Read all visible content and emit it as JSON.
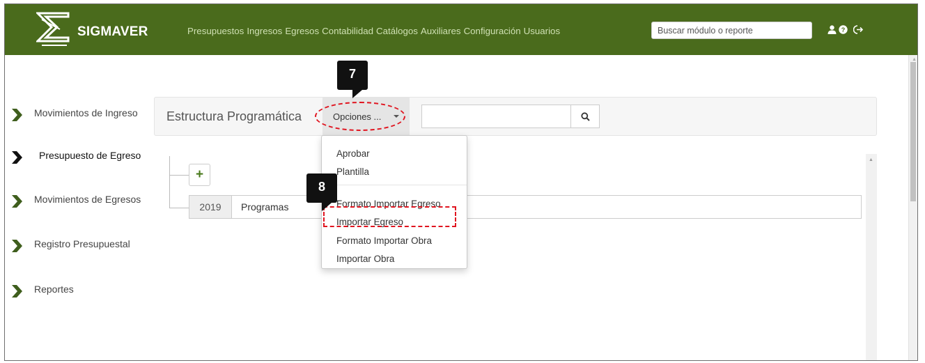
{
  "app": {
    "brand": "SIGMAVER",
    "colors": {
      "topbar": "#4a6b1c",
      "nav_text": "#cfe0b3",
      "chevron": "#3f5e1d",
      "annotation": "#e0141f"
    }
  },
  "nav": {
    "items": [
      "Presupuestos",
      "Ingresos",
      "Egresos",
      "Contabilidad",
      "Catálogos",
      "Auxiliares",
      "Configuración",
      "Usuarios"
    ],
    "search_placeholder": "Buscar módulo o reporte",
    "icons": [
      "user-icon",
      "help-icon",
      "logout-icon"
    ]
  },
  "sidebar": {
    "items": [
      {
        "label": "Movimientos de Ingreso"
      },
      {
        "label": "Presupuesto de Egreso"
      },
      {
        "label": "Movimientos de Egresos"
      },
      {
        "label": "Registro Presupuestal"
      },
      {
        "label": "Reportes"
      }
    ]
  },
  "toolbar": {
    "title": "Estructura Programática",
    "options_label": "Opciones ...",
    "search_value": ""
  },
  "tree": {
    "add_label": "+",
    "row": {
      "year": "2019",
      "label": "Programas"
    }
  },
  "dropdown": {
    "items": [
      "Aprobar",
      "Plantilla",
      "Formato Importar Egreso",
      "Importar Egreso",
      "Formato Importar Obra",
      "Importar Obra"
    ]
  },
  "annotations": {
    "step7": "7",
    "step8": "8"
  }
}
